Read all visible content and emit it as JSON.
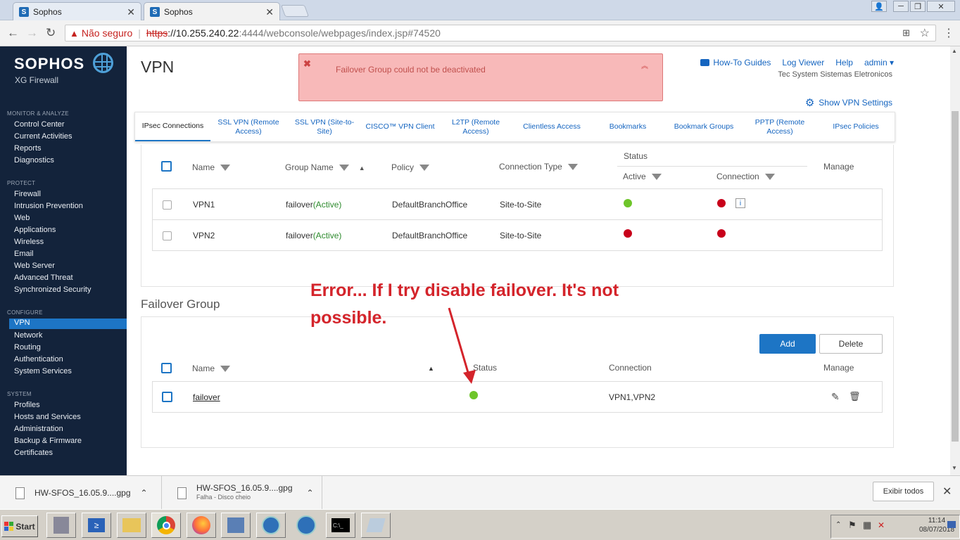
{
  "browser": {
    "tabs": [
      {
        "label": "Sophos"
      },
      {
        "label": "Sophos"
      }
    ],
    "address": {
      "insecure_label": "Não seguro",
      "scheme": "https",
      "host": "://10.255.240.22",
      "path": ":4444/webconsole/webpages/index.jsp#74520"
    }
  },
  "sidebar": {
    "brand": "SOPHOS",
    "product": "XG Firewall",
    "sections": [
      {
        "title": "MONITOR & ANALYZE",
        "items": [
          "Control Center",
          "Current Activities",
          "Reports",
          "Diagnostics"
        ]
      },
      {
        "title": "PROTECT",
        "items": [
          "Firewall",
          "Intrusion Prevention",
          "Web",
          "Applications",
          "Wireless",
          "Email",
          "Web Server",
          "Advanced Threat",
          "Synchronized Security"
        ]
      },
      {
        "title": "CONFIGURE",
        "items": [
          "VPN",
          "Network",
          "Routing",
          "Authentication",
          "System Services"
        ]
      },
      {
        "title": "SYSTEM",
        "items": [
          "Profiles",
          "Hosts and Services",
          "Administration",
          "Backup & Firmware",
          "Certificates"
        ]
      }
    ],
    "selected": "VPN"
  },
  "header": {
    "title": "VPN",
    "error": "Failover Group could not be deactivated",
    "links": {
      "howto": "How-To Guides",
      "logviewer": "Log Viewer",
      "help": "Help",
      "admin": "admin"
    },
    "company": "Tec System Sistemas Eletronicos",
    "show_settings": "Show VPN Settings"
  },
  "tabs": [
    "IPsec Connections",
    "SSL VPN (Remote Access)",
    "SSL VPN (Site-to-Site)",
    "CISCO™ VPN Client",
    "L2TP (Remote Access)",
    "Clientless Access",
    "Bookmarks",
    "Bookmark Groups",
    "PPTP (Remote Access)",
    "IPsec Policies"
  ],
  "ipsec_table": {
    "headers": {
      "name": "Name",
      "group": "Group Name",
      "policy": "Policy",
      "conn_type": "Connection Type",
      "status": "Status",
      "active": "Active",
      "connection": "Connection",
      "manage": "Manage"
    },
    "rows": [
      {
        "name": "VPN1",
        "group": "failover",
        "group_state": "(Active)",
        "policy": "DefaultBranchOffice",
        "type": "Site-to-Site",
        "active": "green",
        "connection": "red"
      },
      {
        "name": "VPN2",
        "group": "failover",
        "group_state": "(Active)",
        "policy": "DefaultBranchOffice",
        "type": "Site-to-Site",
        "active": "red",
        "connection": "red"
      }
    ]
  },
  "failover": {
    "title": "Failover Group",
    "add": "Add",
    "delete": "Delete",
    "headers": {
      "name": "Name",
      "status": "Status",
      "connection": "Connection",
      "manage": "Manage"
    },
    "rows": [
      {
        "name": "failover",
        "status": "green",
        "connection": "VPN1,VPN2"
      }
    ]
  },
  "annotation": "Error... If I try disable failover. It's not possible.",
  "downloads": [
    {
      "file": "HW-SFOS_16.05.9....gpg",
      "sub": ""
    },
    {
      "file": "HW-SFOS_16.05.9....gpg",
      "sub": "Falha - Disco cheio"
    }
  ],
  "downloads_show_all": "Exibir todos",
  "taskbar": {
    "start": "Start",
    "time": "11:14",
    "date": "08/07/2018"
  },
  "colors": {
    "sidebar": "#13233b",
    "accent": "#1d75c5",
    "link": "#1565c0",
    "error_bg": "#f8b9b9",
    "dot_green": "#6ec52a",
    "dot_red": "#c8001a"
  }
}
